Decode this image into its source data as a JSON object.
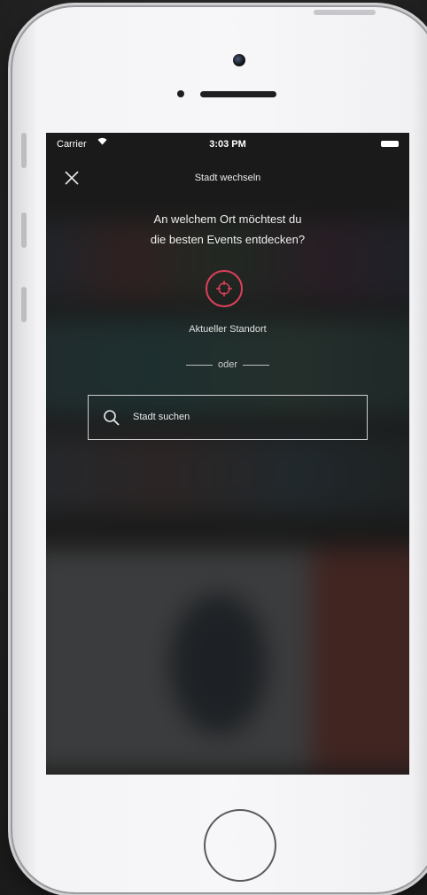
{
  "status_bar": {
    "carrier": "Carrier",
    "time": "3:03 PM"
  },
  "nav": {
    "title": "Stadt wechseln",
    "close_icon": "close-icon"
  },
  "prompt": {
    "line1": "An welchem Ort möchtest du",
    "line2": "die besten Events entdecken?"
  },
  "location": {
    "label": "Aktueller Standort",
    "icon": "crosshair-icon",
    "accent": "#e0405a"
  },
  "separator": {
    "text": "oder"
  },
  "search": {
    "placeholder": "Stadt suchen",
    "icon": "search-icon"
  }
}
